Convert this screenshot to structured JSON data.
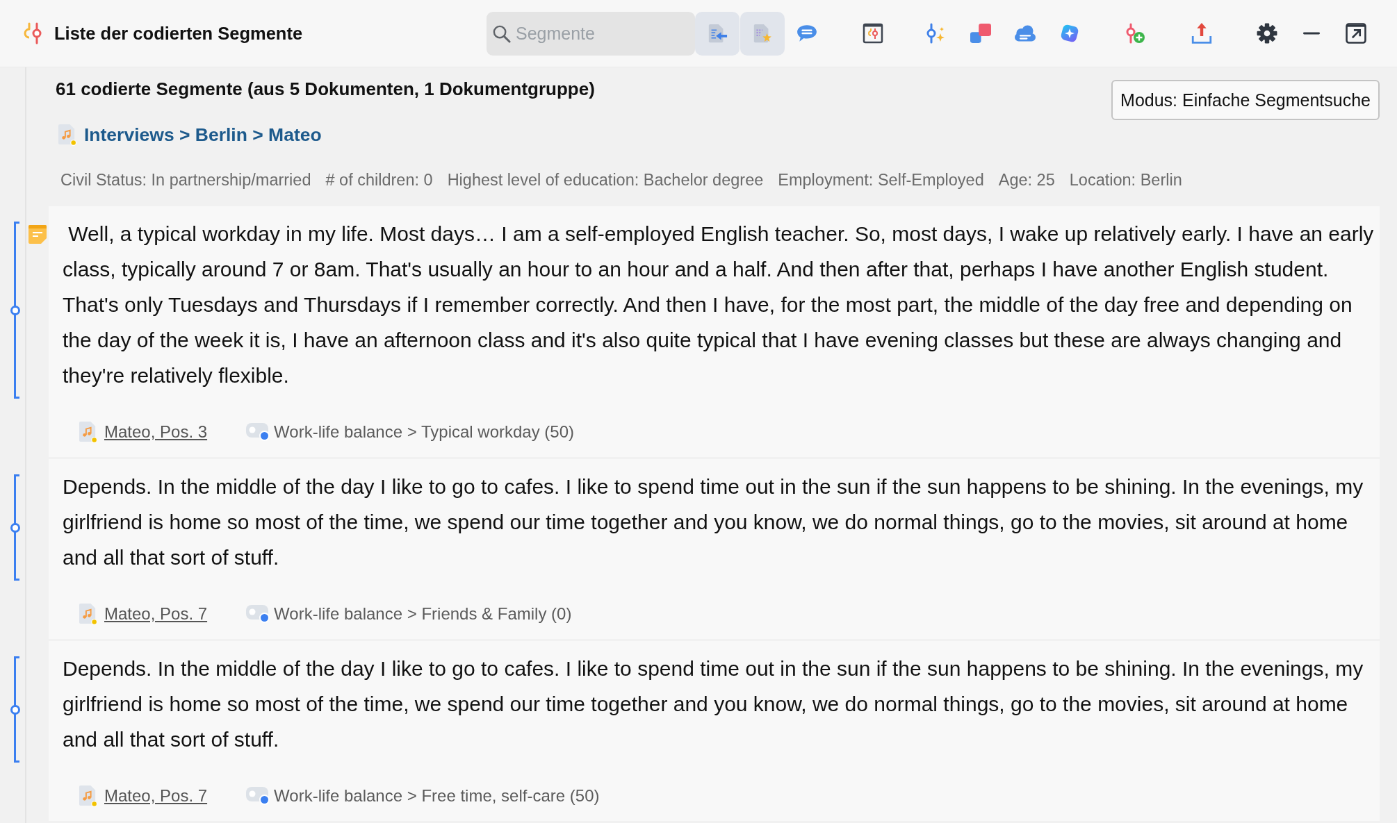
{
  "window": {
    "title": "Liste der codierten Segmente"
  },
  "search": {
    "placeholder": "Segmente"
  },
  "toolbar": [
    {
      "kind": "import",
      "selected": true
    },
    {
      "kind": "favorites",
      "selected": true
    },
    {
      "kind": "comment",
      "selected": false
    },
    {
      "kind": "codewindow",
      "selected": false
    },
    {
      "kind": "smartcode",
      "selected": false
    },
    {
      "kind": "overlap",
      "selected": false
    },
    {
      "kind": "cloud",
      "selected": false
    },
    {
      "kind": "assistant",
      "selected": false
    },
    {
      "kind": "addcode",
      "selected": false
    },
    {
      "kind": "export",
      "selected": false
    },
    {
      "kind": "settings",
      "selected": false
    },
    {
      "kind": "minimize",
      "selected": false
    },
    {
      "kind": "popout",
      "selected": false
    }
  ],
  "summary": "61 codierte Segmente (aus 5 Dokumenten, 1 Dokumentgruppe)",
  "mode_button": "Modus: Einfache Segmentsuche",
  "document": {
    "path": "Interviews > Berlin > Mateo",
    "attributes": [
      "Civil Status: In partnership/married",
      "# of children: 0",
      "Highest level of education: Bachelor degree",
      "Employment: Self-Employed",
      "Age: 25",
      "Location: Berlin"
    ]
  },
  "segments": [
    {
      "memo": true,
      "text": " Well, a typical workday in my life. Most days… I am a self-employed English teacher. So, most days, I wake up relatively early. I have an early class, typically around 7 or 8am. That's usually an hour to an hour and a half. And then after that, perhaps I have another English student. That's only Tuesdays and Thursdays if I remember correctly. And then I have, for the most part, the middle of the day free and depending on the day of the week it is, I have an afternoon class and it's also quite typical that I have evening classes but these are always changing and they're relatively flexible.",
      "source": "Mateo, Pos. 3",
      "code": {
        "path": "Work-life balance > Typical workday (50)",
        "color": "#3b7ff0"
      }
    },
    {
      "memo": false,
      "text": "Depends. In the middle of the day I like to go to cafes. I like to spend time out in the sun if the sun happens to be shining. In the evenings, my girlfriend is home so most of the time, we spend our time together and you know, we do normal things, go to the movies, sit around at home and all that sort of stuff.",
      "source": "Mateo, Pos. 7",
      "code": {
        "path": "Work-life balance > Friends & Family (0)",
        "color": "#3b7ff0"
      }
    },
    {
      "memo": false,
      "text": "Depends. In the middle of the day I like to go to cafes. I like to spend time out in the sun if the sun happens to be shining. In the evenings, my girlfriend is home so most of the time, we spend our time together and you know, we do normal things, go to the movies, sit around at home and all that sort of stuff.",
      "source": "Mateo, Pos. 7",
      "code": {
        "path": "Work-life balance > Free time, self-care (50)",
        "color": "#3b7ff0"
      }
    }
  ]
}
